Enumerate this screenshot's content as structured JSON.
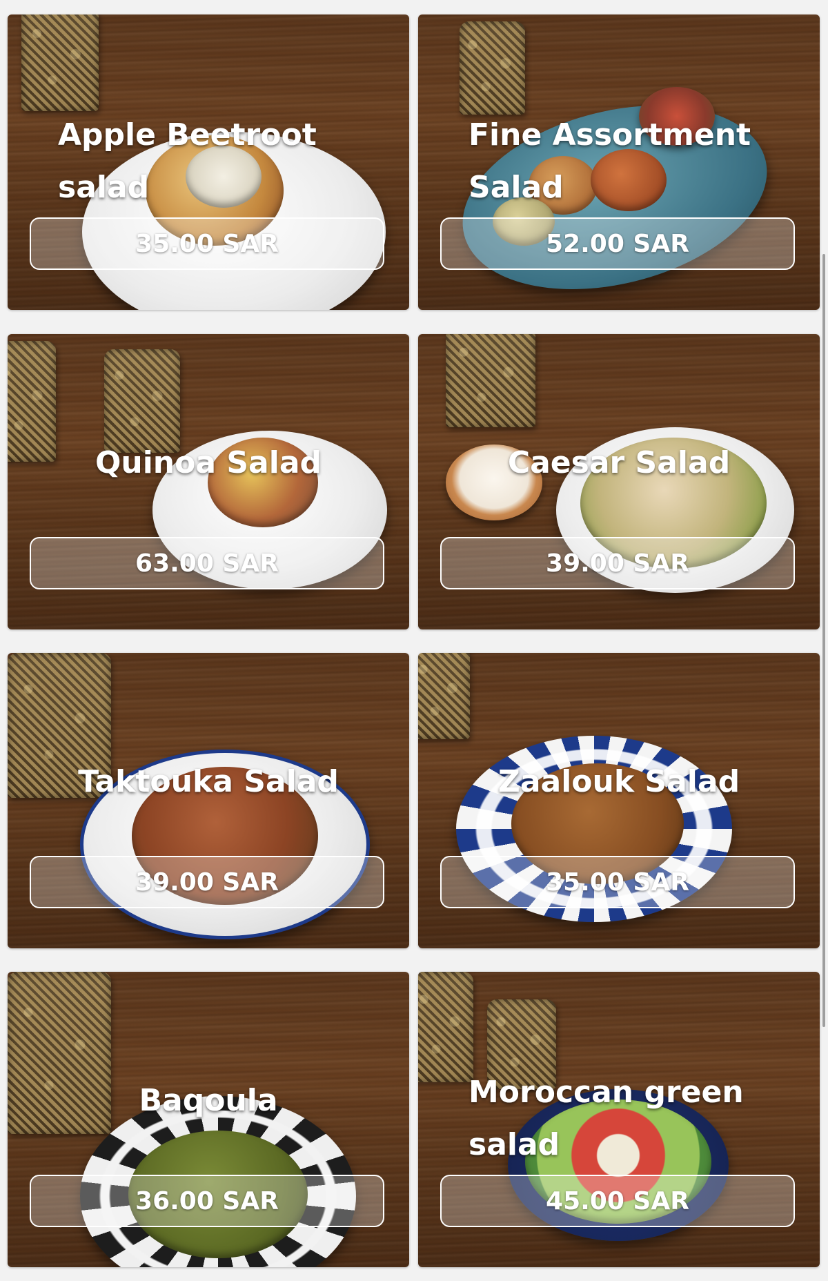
{
  "menu": {
    "items": [
      {
        "name": "Apple Beetroot salad",
        "price": "35.00 SAR"
      },
      {
        "name": "Fine Assortment Salad",
        "price": "52.00 SAR"
      },
      {
        "name": "Quinoa Salad",
        "price": "63.00 SAR"
      },
      {
        "name": "Caesar Salad",
        "price": "39.00 SAR"
      },
      {
        "name": "Taktouka Salad",
        "price": "39.00 SAR"
      },
      {
        "name": "Zaalouk Salad",
        "price": "35.00 SAR"
      },
      {
        "name": "Baqoula",
        "price": "36.00 SAR"
      },
      {
        "name": "Moroccan green salad",
        "price": "45.00 SAR"
      }
    ]
  },
  "colors": {
    "page_background": "#f2f2f2",
    "wood": "#5e3a1f",
    "text": "#ffffff"
  }
}
